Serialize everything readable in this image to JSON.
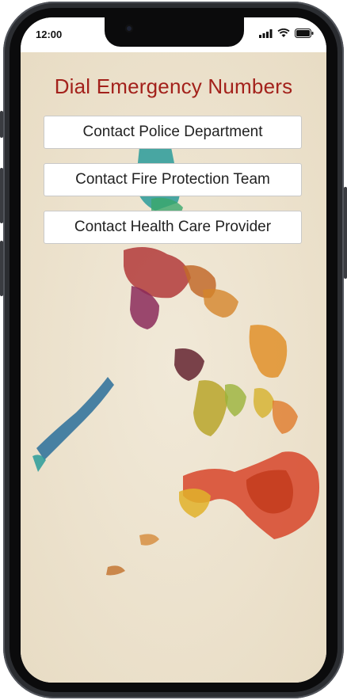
{
  "status_bar": {
    "time": "12:00"
  },
  "page": {
    "title": "Dial Emergency Numbers",
    "buttons": [
      {
        "label": "Contact Police Department"
      },
      {
        "label": "Contact Fire Protection Team"
      },
      {
        "label": "Contact Health Care Provider"
      }
    ]
  },
  "colors": {
    "title": "#a3211b",
    "background": "#efe6d4"
  },
  "icons": [
    "signal-icon",
    "wifi-icon",
    "battery-icon",
    "camera-icon"
  ]
}
